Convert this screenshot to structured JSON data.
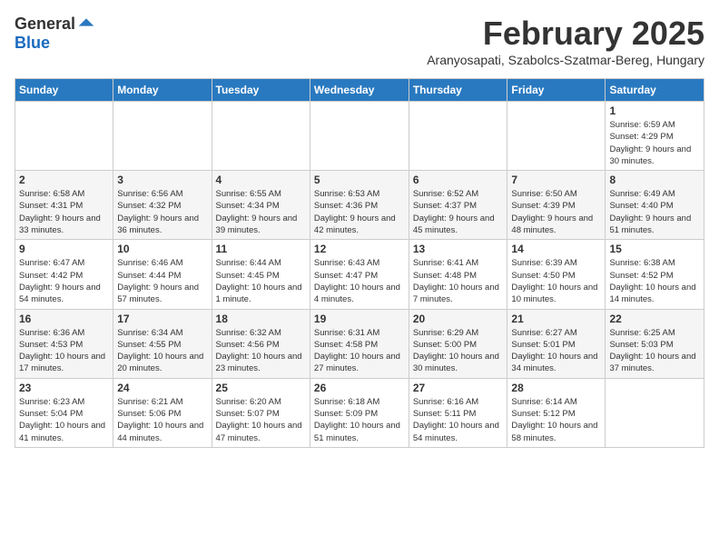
{
  "logo": {
    "general": "General",
    "blue": "Blue"
  },
  "header": {
    "month_title": "February 2025",
    "subtitle": "Aranyosapati, Szabolcs-Szatmar-Bereg, Hungary"
  },
  "weekdays": [
    "Sunday",
    "Monday",
    "Tuesday",
    "Wednesday",
    "Thursday",
    "Friday",
    "Saturday"
  ],
  "weeks": [
    [
      {
        "day": "",
        "info": ""
      },
      {
        "day": "",
        "info": ""
      },
      {
        "day": "",
        "info": ""
      },
      {
        "day": "",
        "info": ""
      },
      {
        "day": "",
        "info": ""
      },
      {
        "day": "",
        "info": ""
      },
      {
        "day": "1",
        "info": "Sunrise: 6:59 AM\nSunset: 4:29 PM\nDaylight: 9 hours and 30 minutes."
      }
    ],
    [
      {
        "day": "2",
        "info": "Sunrise: 6:58 AM\nSunset: 4:31 PM\nDaylight: 9 hours and 33 minutes."
      },
      {
        "day": "3",
        "info": "Sunrise: 6:56 AM\nSunset: 4:32 PM\nDaylight: 9 hours and 36 minutes."
      },
      {
        "day": "4",
        "info": "Sunrise: 6:55 AM\nSunset: 4:34 PM\nDaylight: 9 hours and 39 minutes."
      },
      {
        "day": "5",
        "info": "Sunrise: 6:53 AM\nSunset: 4:36 PM\nDaylight: 9 hours and 42 minutes."
      },
      {
        "day": "6",
        "info": "Sunrise: 6:52 AM\nSunset: 4:37 PM\nDaylight: 9 hours and 45 minutes."
      },
      {
        "day": "7",
        "info": "Sunrise: 6:50 AM\nSunset: 4:39 PM\nDaylight: 9 hours and 48 minutes."
      },
      {
        "day": "8",
        "info": "Sunrise: 6:49 AM\nSunset: 4:40 PM\nDaylight: 9 hours and 51 minutes."
      }
    ],
    [
      {
        "day": "9",
        "info": "Sunrise: 6:47 AM\nSunset: 4:42 PM\nDaylight: 9 hours and 54 minutes."
      },
      {
        "day": "10",
        "info": "Sunrise: 6:46 AM\nSunset: 4:44 PM\nDaylight: 9 hours and 57 minutes."
      },
      {
        "day": "11",
        "info": "Sunrise: 6:44 AM\nSunset: 4:45 PM\nDaylight: 10 hours and 1 minute."
      },
      {
        "day": "12",
        "info": "Sunrise: 6:43 AM\nSunset: 4:47 PM\nDaylight: 10 hours and 4 minutes."
      },
      {
        "day": "13",
        "info": "Sunrise: 6:41 AM\nSunset: 4:48 PM\nDaylight: 10 hours and 7 minutes."
      },
      {
        "day": "14",
        "info": "Sunrise: 6:39 AM\nSunset: 4:50 PM\nDaylight: 10 hours and 10 minutes."
      },
      {
        "day": "15",
        "info": "Sunrise: 6:38 AM\nSunset: 4:52 PM\nDaylight: 10 hours and 14 minutes."
      }
    ],
    [
      {
        "day": "16",
        "info": "Sunrise: 6:36 AM\nSunset: 4:53 PM\nDaylight: 10 hours and 17 minutes."
      },
      {
        "day": "17",
        "info": "Sunrise: 6:34 AM\nSunset: 4:55 PM\nDaylight: 10 hours and 20 minutes."
      },
      {
        "day": "18",
        "info": "Sunrise: 6:32 AM\nSunset: 4:56 PM\nDaylight: 10 hours and 23 minutes."
      },
      {
        "day": "19",
        "info": "Sunrise: 6:31 AM\nSunset: 4:58 PM\nDaylight: 10 hours and 27 minutes."
      },
      {
        "day": "20",
        "info": "Sunrise: 6:29 AM\nSunset: 5:00 PM\nDaylight: 10 hours and 30 minutes."
      },
      {
        "day": "21",
        "info": "Sunrise: 6:27 AM\nSunset: 5:01 PM\nDaylight: 10 hours and 34 minutes."
      },
      {
        "day": "22",
        "info": "Sunrise: 6:25 AM\nSunset: 5:03 PM\nDaylight: 10 hours and 37 minutes."
      }
    ],
    [
      {
        "day": "23",
        "info": "Sunrise: 6:23 AM\nSunset: 5:04 PM\nDaylight: 10 hours and 41 minutes."
      },
      {
        "day": "24",
        "info": "Sunrise: 6:21 AM\nSunset: 5:06 PM\nDaylight: 10 hours and 44 minutes."
      },
      {
        "day": "25",
        "info": "Sunrise: 6:20 AM\nSunset: 5:07 PM\nDaylight: 10 hours and 47 minutes."
      },
      {
        "day": "26",
        "info": "Sunrise: 6:18 AM\nSunset: 5:09 PM\nDaylight: 10 hours and 51 minutes."
      },
      {
        "day": "27",
        "info": "Sunrise: 6:16 AM\nSunset: 5:11 PM\nDaylight: 10 hours and 54 minutes."
      },
      {
        "day": "28",
        "info": "Sunrise: 6:14 AM\nSunset: 5:12 PM\nDaylight: 10 hours and 58 minutes."
      },
      {
        "day": "",
        "info": ""
      }
    ]
  ]
}
